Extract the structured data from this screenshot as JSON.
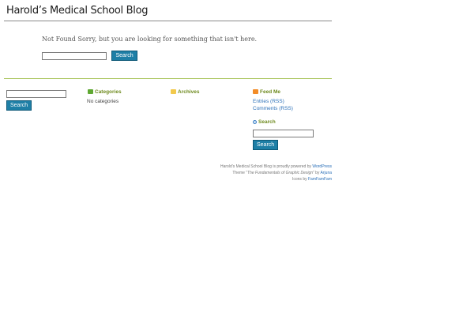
{
  "header": {
    "site_title": "Harold’s Medical School Blog"
  },
  "main": {
    "not_found_message": "Not Found Sorry, but you are looking for something that isn't here.",
    "search_value": "",
    "search_button_label": "Search"
  },
  "footer": {
    "search": {
      "value": "",
      "button_label": "Search"
    },
    "categories": {
      "title": "Categories",
      "empty_text": "No categories"
    },
    "archives": {
      "title": "Archives"
    },
    "feeds": {
      "title": "Feed Me",
      "entries_link": "Entries (RSS)",
      "comments_link": "Comments (RSS)"
    },
    "sidebar_search": {
      "title": "Search",
      "value": "",
      "button_label": "Search"
    },
    "credits": {
      "line1_prefix": "Harold’s Medical School Blog is proudly powered by ",
      "line1_link": "WordPress",
      "line2_prefix": "Theme “",
      "line2_theme": "The Fundamentals of Graphic Design",
      "line2_mid": "” by ",
      "line2_link": "Arjuna",
      "line3_prefix": "Icons by ",
      "line3_link": "FamFamFam"
    }
  },
  "colors": {
    "accent_button": "#1e7fa6",
    "widget_title": "#6e8a1e",
    "link": "#2a6fb8",
    "divider_green": "#a8c45a"
  },
  "icons": {
    "categories": "folder-green-icon",
    "archives": "folder-yellow-icon",
    "feeds": "rss-icon",
    "search": "magnifier-icon"
  }
}
